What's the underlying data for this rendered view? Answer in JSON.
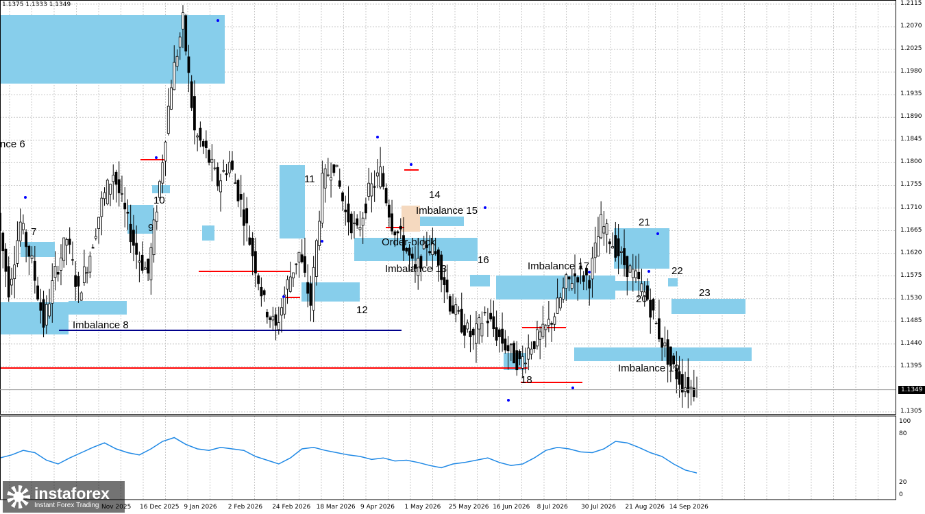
{
  "ohlc_header": "1.1375 1.1333 1.1349",
  "current_price": "1.1349",
  "price_axis": [
    "1.2115",
    "1.2070",
    "1.2025",
    "1.1980",
    "1.1935",
    "1.1890",
    "1.1845",
    "1.1800",
    "1.1755",
    "1.1710",
    "1.1665",
    "1.1620",
    "1.1575",
    "1.1530",
    "1.1485",
    "1.1440",
    "1.1395",
    "1.1305"
  ],
  "indicator_axis": [
    "100",
    "80",
    "20",
    "0"
  ],
  "time_axis": [
    "16 Dec 2025",
    "9 Jan 2026",
    "2 Feb 2026",
    "24 Feb 2026",
    "18 Mar 2026",
    "9 Apr 2026",
    "1 May 2026",
    "25 May 2026",
    "16 Jun 2026",
    "8 Jul 2026",
    "30 Jul 2026",
    "21 Aug 2026",
    "14 Sep 2026"
  ],
  "time_axis_partial": "Nov 2025",
  "zone_labels": {
    "imbalance6": "nce 6",
    "n7": "7",
    "imbalance8": "Imbalance 8",
    "n9": "9",
    "n10": "10",
    "n11": "11",
    "n12": "12",
    "imbalance13": "Imbalance 13",
    "n14": "14",
    "imbalance15": "Imbalance 15",
    "orderblock": "Order-block",
    "n16": "16",
    "imbalance17": "Imbalance 17",
    "n18": "18",
    "imbalance19": "Imbalance 19",
    "n20": "20",
    "n21": "21",
    "n22": "22",
    "n23": "23"
  },
  "colors": {
    "zone": "#87ceeb",
    "orderblock": "#f5d9bf",
    "level_red": "#ff0000",
    "level_blue": "#00008b",
    "indicator": "#1e88e5",
    "candle": "#000000",
    "arrow": "#0000ff"
  },
  "logo": {
    "name": "instaforex",
    "tagline": "Instant Forex Trading",
    "icon": "instaforex-logo-icon"
  },
  "chart_data": {
    "type": "candlestick",
    "symbol_ohlc": "1.1375 1.1333 1.1349",
    "y_range": [
      1.129,
      1.212
    ],
    "x_labels": [
      "16 Dec 2025",
      "9 Jan 2026",
      "2 Feb 2026",
      "24 Feb 2026",
      "18 Mar 2026",
      "9 Apr 2026",
      "1 May 2026",
      "25 May 2026",
      "16 Jun 2026",
      "8 Jul 2026",
      "30 Jul 2026",
      "21 Aug 2026",
      "14 Sep 2026"
    ],
    "close_path": [
      1.17,
      1.155,
      1.168,
      1.16,
      1.148,
      1.158,
      1.165,
      1.154,
      1.162,
      1.172,
      1.178,
      1.17,
      1.162,
      1.158,
      1.176,
      1.196,
      1.208,
      1.186,
      1.182,
      1.176,
      1.18,
      1.172,
      1.162,
      1.152,
      1.147,
      1.156,
      1.162,
      1.152,
      1.176,
      1.18,
      1.17,
      1.166,
      1.174,
      1.178,
      1.168,
      1.164,
      1.158,
      1.164,
      1.161,
      1.152,
      1.148,
      1.145,
      1.15,
      1.146,
      1.143,
      1.14,
      1.144,
      1.146,
      1.15,
      1.156,
      1.158,
      1.157,
      1.168,
      1.164,
      1.16,
      1.157,
      1.153,
      1.146,
      1.14,
      1.136,
      1.135
    ],
    "indicator": {
      "name": "oscillator",
      "y_range": [
        0,
        100
      ],
      "values": [
        48,
        52,
        58,
        55,
        45,
        40,
        48,
        55,
        62,
        68,
        60,
        55,
        52,
        60,
        70,
        75,
        66,
        60,
        58,
        62,
        60,
        58,
        50,
        45,
        40,
        48,
        60,
        62,
        58,
        55,
        52,
        50,
        46,
        48,
        44,
        45,
        42,
        38,
        35,
        40,
        42,
        45,
        48,
        42,
        38,
        40,
        48,
        58,
        62,
        60,
        56,
        55,
        60,
        70,
        68,
        62,
        55,
        50,
        40,
        32,
        28
      ]
    }
  }
}
